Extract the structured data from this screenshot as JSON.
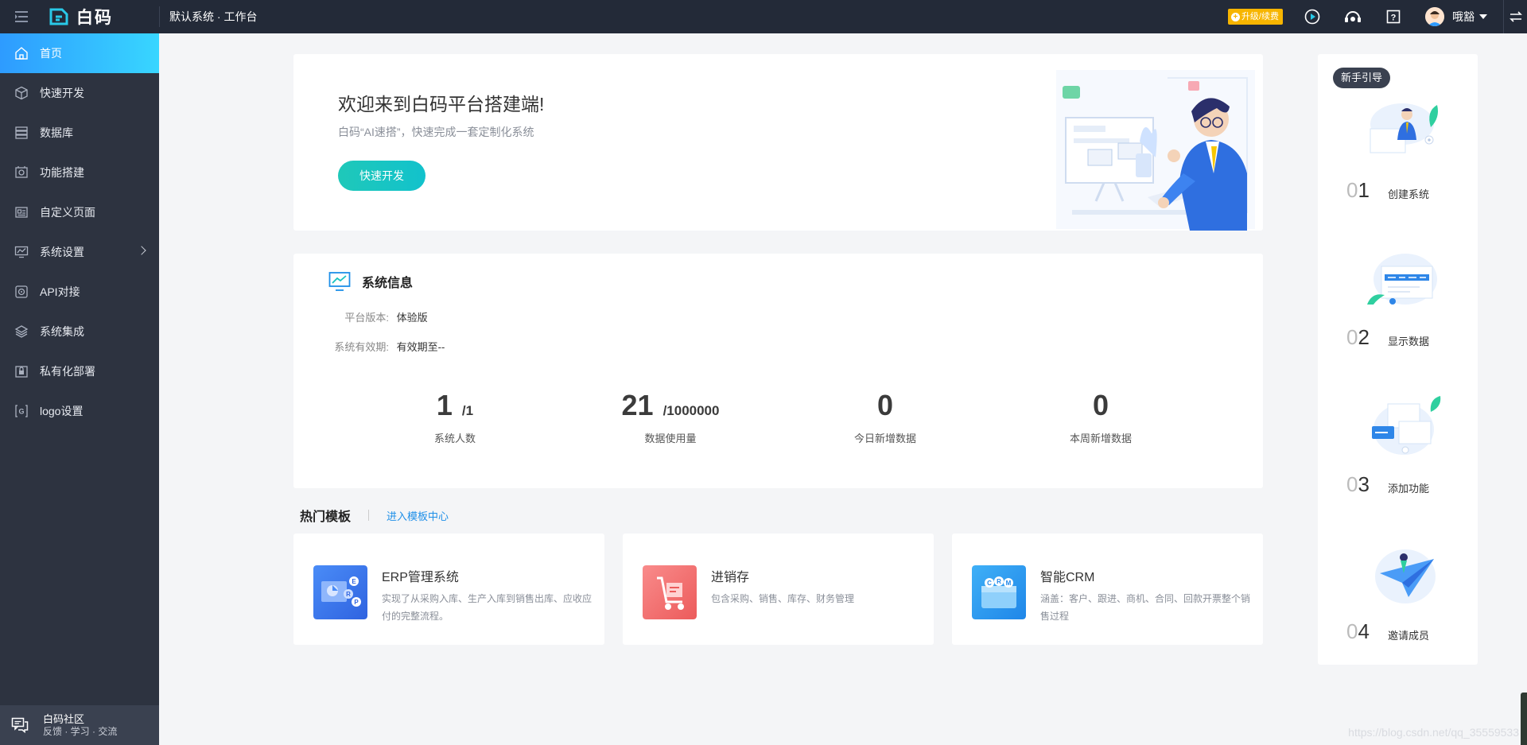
{
  "header": {
    "logo_text": "白码",
    "system_title": "默认系统 · 工作台",
    "upgrade_label": "升级/续费",
    "username": "哦豁"
  },
  "sidebar": {
    "items": [
      {
        "label": "首页",
        "icon": "home-icon"
      },
      {
        "label": "快速开发",
        "icon": "cube-icon"
      },
      {
        "label": "数据库",
        "icon": "database-icon"
      },
      {
        "label": "功能搭建",
        "icon": "build-icon"
      },
      {
        "label": "自定义页面",
        "icon": "page-icon"
      },
      {
        "label": "系统设置",
        "icon": "monitor-icon"
      },
      {
        "label": "API对接",
        "icon": "api-icon"
      },
      {
        "label": "系统集成",
        "icon": "layers-icon"
      },
      {
        "label": "私有化部署",
        "icon": "lock-icon"
      },
      {
        "label": "logo设置",
        "icon": "logo-icon"
      }
    ],
    "community_title": "白码社区",
    "community_sub": "反馈 · 学习 · 交流"
  },
  "welcome": {
    "title": "欢迎来到白码平台搭建端!",
    "subtitle": "白码“AI速搭”，快速完成一套定制化系统",
    "button": "快速开发"
  },
  "system_info": {
    "title": "系统信息",
    "version_label": "平台版本:",
    "version_value": "体验版",
    "expire_label": "系统有效期:",
    "expire_value": "有效期至--",
    "stats": [
      {
        "value": "1",
        "total": "/1",
        "label": "系统人数"
      },
      {
        "value": "21",
        "total": "/1000000",
        "label": "数据使用量"
      },
      {
        "value": "0",
        "total": "",
        "label": "今日新增数据"
      },
      {
        "value": "0",
        "total": "",
        "label": "本周新增数据"
      }
    ]
  },
  "templates": {
    "title": "热门模板",
    "link": "进入模板中心",
    "items": [
      {
        "name": "ERP管理系统",
        "desc": "实现了从采购入库、生产入库到销售出库、应收应付的完整流程。",
        "color": "#3f7cf0"
      },
      {
        "name": "进销存",
        "desc": "包含采购、销售、库存、财务管理",
        "color": "#f06a6a"
      },
      {
        "name": "智能CRM",
        "desc": "涵盖：客户、跟进、商机、合同、回款开票整个销售过程",
        "color": "#2e9bf0"
      }
    ]
  },
  "guide": {
    "badge": "新手引导",
    "steps": [
      {
        "zero": "0",
        "digit": "1",
        "label": "创建系统"
      },
      {
        "zero": "0",
        "digit": "2",
        "label": "显示数据"
      },
      {
        "zero": "0",
        "digit": "3",
        "label": "添加功能"
      },
      {
        "zero": "0",
        "digit": "4",
        "label": "邀请成员"
      }
    ]
  },
  "watermark": "https://blog.csdn.net/qq_35559533"
}
